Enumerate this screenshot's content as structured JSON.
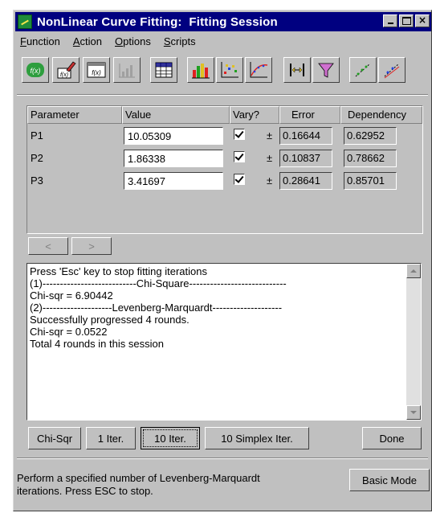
{
  "window": {
    "title": "NonLinear Curve Fitting:  Fitting Session"
  },
  "menu": [
    "Function",
    "Action",
    "Options",
    "Scripts"
  ],
  "toolbar": {
    "buttons": [
      {
        "icon": "f-param-icon"
      },
      {
        "icon": "edit-function-icon"
      },
      {
        "icon": "function-window-icon"
      },
      {
        "icon": "chart-disabled-icon"
      },
      {
        "icon": "table-grid-icon"
      },
      {
        "icon": "color-bars-icon"
      },
      {
        "icon": "scatter-plot-icon"
      },
      {
        "icon": "fit-curve-icon"
      },
      {
        "icon": "range-markers-icon"
      },
      {
        "icon": "weight-funnel-icon"
      },
      {
        "icon": "dataset-icon"
      },
      {
        "icon": "dataset-fit-icon"
      }
    ]
  },
  "params": {
    "headers": {
      "parameter": "Parameter",
      "value": "Value",
      "vary": "Vary?",
      "error": "Error",
      "dependency": "Dependency"
    },
    "rows": [
      {
        "name": "P1",
        "value": "10.05309",
        "vary": true,
        "pm": "±",
        "error": "0.16644",
        "dependency": "0.62952"
      },
      {
        "name": "P2",
        "value": "1.86338",
        "vary": true,
        "pm": "±",
        "error": "0.10837",
        "dependency": "0.78662"
      },
      {
        "name": "P3",
        "value": "3.41697",
        "vary": true,
        "pm": "±",
        "error": "0.28641",
        "dependency": "0.85701"
      }
    ]
  },
  "nav": {
    "prev": "<",
    "next": ">"
  },
  "log": {
    "lines": [
      "Press 'Esc' key to stop fitting iterations",
      "(1)---------------------------Chi-Square----------------------------",
      "Chi-sqr = 6.90442",
      "(2)--------------------Levenberg-Marquardt--------------------",
      "Successfully progressed 4 rounds.",
      "Chi-sqr = 0.0522",
      "Total 4 rounds in this session"
    ]
  },
  "actions": {
    "chi_sqr": "Chi-Sqr",
    "one_iter": "1 Iter.",
    "ten_iter": "10 Iter.",
    "ten_simplex": "10 Simplex Iter.",
    "done": "Done",
    "basic_mode": "Basic Mode"
  },
  "status": {
    "text": "Perform a specified number of Levenberg-Marquardt\niterations. Press ESC to stop."
  }
}
